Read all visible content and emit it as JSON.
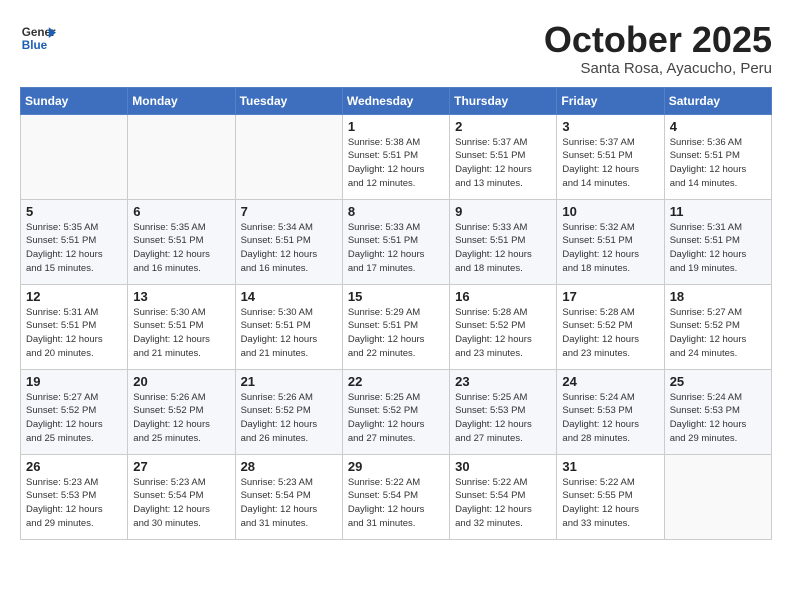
{
  "header": {
    "logo_line1": "General",
    "logo_line2": "Blue",
    "month": "October 2025",
    "location": "Santa Rosa, Ayacucho, Peru"
  },
  "days_of_week": [
    "Sunday",
    "Monday",
    "Tuesday",
    "Wednesday",
    "Thursday",
    "Friday",
    "Saturday"
  ],
  "weeks": [
    [
      {
        "num": "",
        "info": ""
      },
      {
        "num": "",
        "info": ""
      },
      {
        "num": "",
        "info": ""
      },
      {
        "num": "1",
        "info": "Sunrise: 5:38 AM\nSunset: 5:51 PM\nDaylight: 12 hours\nand 12 minutes."
      },
      {
        "num": "2",
        "info": "Sunrise: 5:37 AM\nSunset: 5:51 PM\nDaylight: 12 hours\nand 13 minutes."
      },
      {
        "num": "3",
        "info": "Sunrise: 5:37 AM\nSunset: 5:51 PM\nDaylight: 12 hours\nand 14 minutes."
      },
      {
        "num": "4",
        "info": "Sunrise: 5:36 AM\nSunset: 5:51 PM\nDaylight: 12 hours\nand 14 minutes."
      }
    ],
    [
      {
        "num": "5",
        "info": "Sunrise: 5:35 AM\nSunset: 5:51 PM\nDaylight: 12 hours\nand 15 minutes."
      },
      {
        "num": "6",
        "info": "Sunrise: 5:35 AM\nSunset: 5:51 PM\nDaylight: 12 hours\nand 16 minutes."
      },
      {
        "num": "7",
        "info": "Sunrise: 5:34 AM\nSunset: 5:51 PM\nDaylight: 12 hours\nand 16 minutes."
      },
      {
        "num": "8",
        "info": "Sunrise: 5:33 AM\nSunset: 5:51 PM\nDaylight: 12 hours\nand 17 minutes."
      },
      {
        "num": "9",
        "info": "Sunrise: 5:33 AM\nSunset: 5:51 PM\nDaylight: 12 hours\nand 18 minutes."
      },
      {
        "num": "10",
        "info": "Sunrise: 5:32 AM\nSunset: 5:51 PM\nDaylight: 12 hours\nand 18 minutes."
      },
      {
        "num": "11",
        "info": "Sunrise: 5:31 AM\nSunset: 5:51 PM\nDaylight: 12 hours\nand 19 minutes."
      }
    ],
    [
      {
        "num": "12",
        "info": "Sunrise: 5:31 AM\nSunset: 5:51 PM\nDaylight: 12 hours\nand 20 minutes."
      },
      {
        "num": "13",
        "info": "Sunrise: 5:30 AM\nSunset: 5:51 PM\nDaylight: 12 hours\nand 21 minutes."
      },
      {
        "num": "14",
        "info": "Sunrise: 5:30 AM\nSunset: 5:51 PM\nDaylight: 12 hours\nand 21 minutes."
      },
      {
        "num": "15",
        "info": "Sunrise: 5:29 AM\nSunset: 5:51 PM\nDaylight: 12 hours\nand 22 minutes."
      },
      {
        "num": "16",
        "info": "Sunrise: 5:28 AM\nSunset: 5:52 PM\nDaylight: 12 hours\nand 23 minutes."
      },
      {
        "num": "17",
        "info": "Sunrise: 5:28 AM\nSunset: 5:52 PM\nDaylight: 12 hours\nand 23 minutes."
      },
      {
        "num": "18",
        "info": "Sunrise: 5:27 AM\nSunset: 5:52 PM\nDaylight: 12 hours\nand 24 minutes."
      }
    ],
    [
      {
        "num": "19",
        "info": "Sunrise: 5:27 AM\nSunset: 5:52 PM\nDaylight: 12 hours\nand 25 minutes."
      },
      {
        "num": "20",
        "info": "Sunrise: 5:26 AM\nSunset: 5:52 PM\nDaylight: 12 hours\nand 25 minutes."
      },
      {
        "num": "21",
        "info": "Sunrise: 5:26 AM\nSunset: 5:52 PM\nDaylight: 12 hours\nand 26 minutes."
      },
      {
        "num": "22",
        "info": "Sunrise: 5:25 AM\nSunset: 5:52 PM\nDaylight: 12 hours\nand 27 minutes."
      },
      {
        "num": "23",
        "info": "Sunrise: 5:25 AM\nSunset: 5:53 PM\nDaylight: 12 hours\nand 27 minutes."
      },
      {
        "num": "24",
        "info": "Sunrise: 5:24 AM\nSunset: 5:53 PM\nDaylight: 12 hours\nand 28 minutes."
      },
      {
        "num": "25",
        "info": "Sunrise: 5:24 AM\nSunset: 5:53 PM\nDaylight: 12 hours\nand 29 minutes."
      }
    ],
    [
      {
        "num": "26",
        "info": "Sunrise: 5:23 AM\nSunset: 5:53 PM\nDaylight: 12 hours\nand 29 minutes."
      },
      {
        "num": "27",
        "info": "Sunrise: 5:23 AM\nSunset: 5:54 PM\nDaylight: 12 hours\nand 30 minutes."
      },
      {
        "num": "28",
        "info": "Sunrise: 5:23 AM\nSunset: 5:54 PM\nDaylight: 12 hours\nand 31 minutes."
      },
      {
        "num": "29",
        "info": "Sunrise: 5:22 AM\nSunset: 5:54 PM\nDaylight: 12 hours\nand 31 minutes."
      },
      {
        "num": "30",
        "info": "Sunrise: 5:22 AM\nSunset: 5:54 PM\nDaylight: 12 hours\nand 32 minutes."
      },
      {
        "num": "31",
        "info": "Sunrise: 5:22 AM\nSunset: 5:55 PM\nDaylight: 12 hours\nand 33 minutes."
      },
      {
        "num": "",
        "info": ""
      }
    ]
  ]
}
